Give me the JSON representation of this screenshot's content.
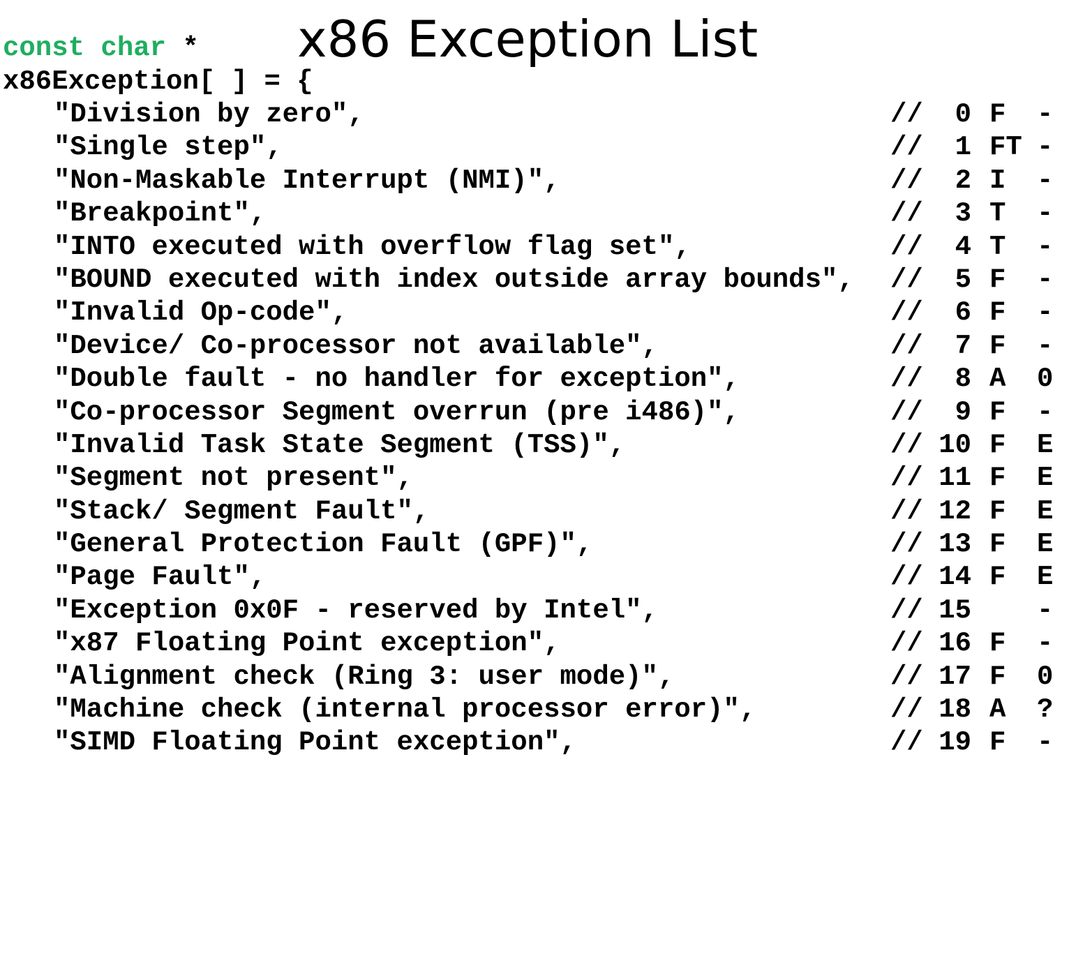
{
  "title": "x86 Exception List",
  "declaration": {
    "keyword": "const char",
    "pointer": " *",
    "line2": "x86Exception[ ] = {"
  },
  "comment_marker": "//",
  "entries": [
    {
      "str": "\"Division by zero\",",
      "num": "0",
      "type": "F",
      "err": "-"
    },
    {
      "str": "\"Single step\",",
      "num": "1",
      "type": "FT",
      "err": "-"
    },
    {
      "str": "\"Non-Maskable Interrupt (NMI)\",",
      "num": "2",
      "type": "I",
      "err": "-"
    },
    {
      "str": "\"Breakpoint\",",
      "num": "3",
      "type": "T",
      "err": "-"
    },
    {
      "str": "\"INTO executed with overflow flag set\",",
      "num": "4",
      "type": "T",
      "err": "-"
    },
    {
      "str": "\"BOUND executed with index outside array bounds\",",
      "num": "5",
      "type": "F",
      "err": "-"
    },
    {
      "str": "\"Invalid Op-code\",",
      "num": "6",
      "type": "F",
      "err": "-"
    },
    {
      "str": "\"Device/ Co-processor not available\",",
      "num": "7",
      "type": "F",
      "err": "-"
    },
    {
      "str": "\"Double fault - no handler for exception\",",
      "num": "8",
      "type": "A",
      "err": "0"
    },
    {
      "str": "\"Co-processor Segment overrun (pre i486)\",",
      "num": "9",
      "type": "F",
      "err": "-"
    },
    {
      "str": "\"Invalid Task State Segment (TSS)\",",
      "num": "10",
      "type": "F",
      "err": "E"
    },
    {
      "str": "\"Segment not present\",",
      "num": "11",
      "type": "F",
      "err": "E"
    },
    {
      "str": "\"Stack/ Segment Fault\",",
      "num": "12",
      "type": "F",
      "err": "E"
    },
    {
      "str": "\"General Protection Fault (GPF)\",",
      "num": "13",
      "type": "F",
      "err": "E"
    },
    {
      "str": "\"Page Fault\",",
      "num": "14",
      "type": "F",
      "err": "E"
    },
    {
      "str": "\"Exception 0x0F - reserved by Intel\",",
      "num": "15",
      "type": "",
      "err": "-"
    },
    {
      "str": "\"x87 Floating Point exception\",",
      "num": "16",
      "type": "F",
      "err": "-"
    },
    {
      "str": "\"Alignment check (Ring 3: user mode)\",",
      "num": "17",
      "type": "F",
      "err": "0"
    },
    {
      "str": "\"Machine check (internal processor error)\",",
      "num": "18",
      "type": "A",
      "err": "?"
    },
    {
      "str": "\"SIMD Floating Point exception\",",
      "num": "19",
      "type": "F",
      "err": "-"
    }
  ],
  "colors": {
    "keyword": "#1fae5f",
    "text": "#000000",
    "background": "#ffffff"
  }
}
